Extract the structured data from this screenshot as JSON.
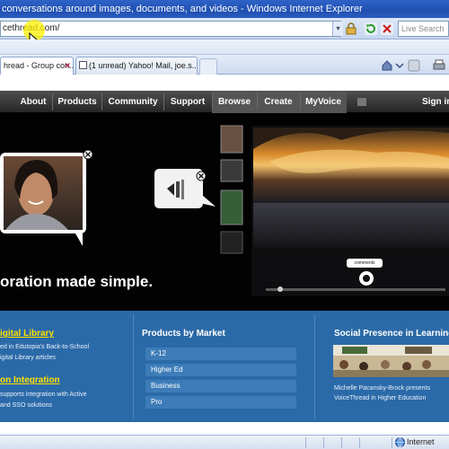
{
  "window": {
    "title": "conversations around images, documents, and videos - Windows Internet Explorer"
  },
  "address_bar": {
    "url": "cethread.com/",
    "search_placeholder": "Live Search"
  },
  "tabs": [
    {
      "label": "hread - Group con...",
      "active": true
    },
    {
      "label": "(1 unread) Yahoo! Mail, joe.s...",
      "active": false
    }
  ],
  "site_nav": {
    "items": [
      "About",
      "Products",
      "Community",
      "Support",
      "Browse",
      "Create",
      "MyVoice"
    ],
    "sign_in": "Sign in"
  },
  "hero": {
    "tagline": "oration made simple.",
    "player_control_label": "comments"
  },
  "lower": {
    "left": {
      "title1": "igital Library",
      "text1_line1": "ed in Edutopia's Back-to-School",
      "text1_line2": "igital Library articles",
      "title2": "on Integration",
      "text2_line1": "supports integration with Active",
      "text2_line2": "and SSO solutions"
    },
    "middle": {
      "title": "Products by Market",
      "items": [
        "K-12",
        "Higher Ed",
        "Business",
        "Pro"
      ]
    },
    "right": {
      "title": "Social Presence in Learning",
      "caption_line1": "Michelle Pacansky-Brock presents",
      "caption_line2": "VoiceThread in Higher Education"
    }
  },
  "status_bar": {
    "zone": "Internet"
  },
  "colors": {
    "nav_bg": "#2f2f2f",
    "lower_bg": "#2b6aa8",
    "title_accent": "#ffe000"
  }
}
